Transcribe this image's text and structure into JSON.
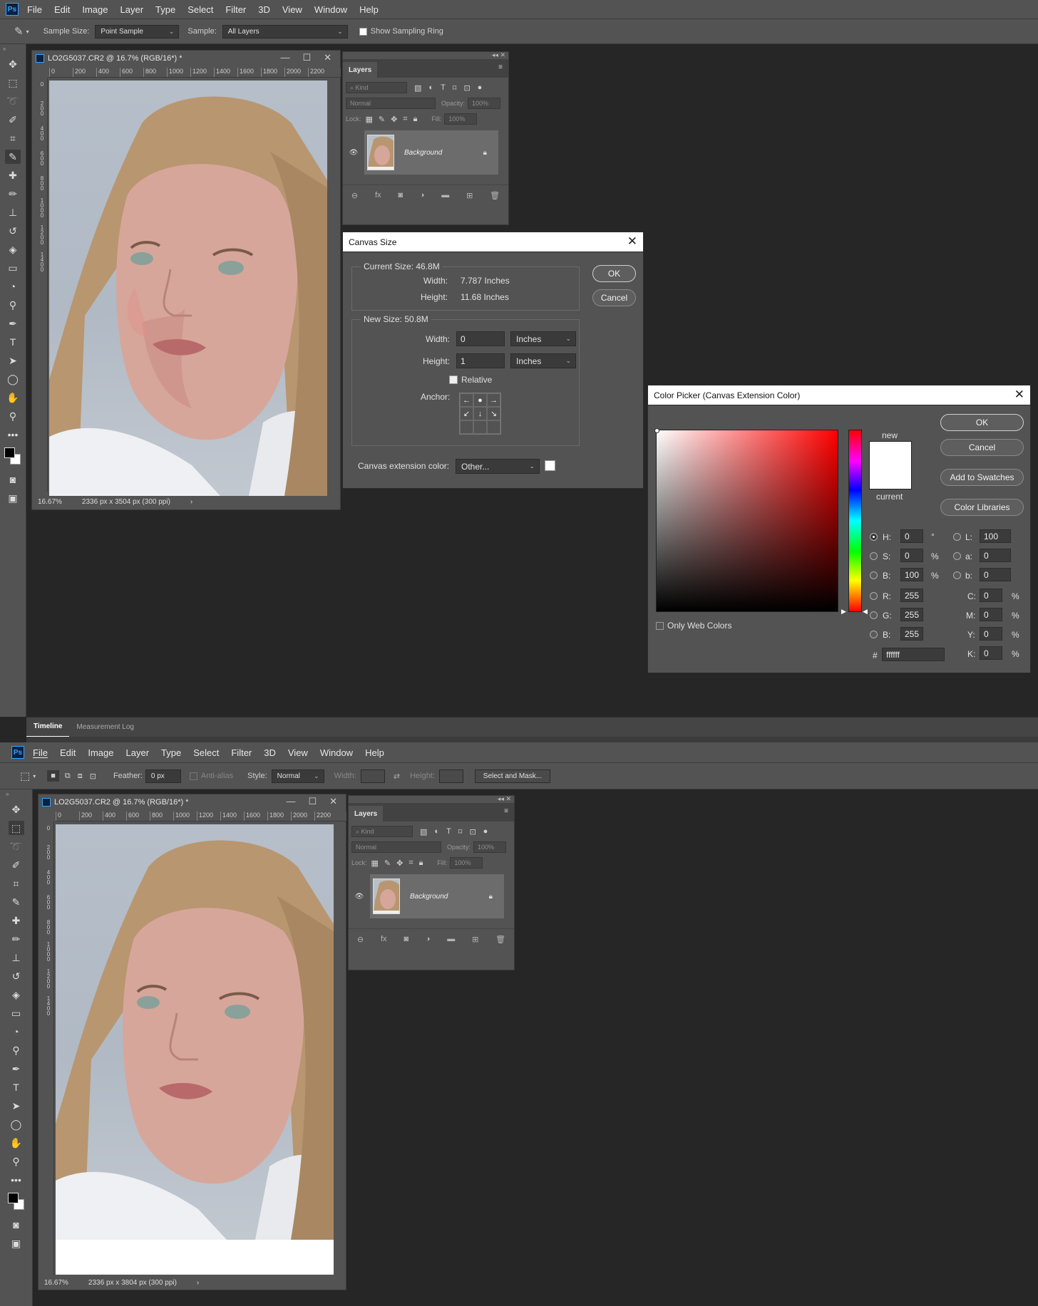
{
  "app": {
    "logo": "Ps"
  },
  "menu": [
    "File",
    "Edit",
    "Image",
    "Layer",
    "Type",
    "Select",
    "Filter",
    "3D",
    "View",
    "Window",
    "Help"
  ],
  "options_top": {
    "sample_size_label": "Sample Size:",
    "sample_size_value": "Point Sample",
    "sample_label": "Sample:",
    "sample_value": "All Layers",
    "sampling_ring_label": "Show Sampling Ring"
  },
  "options_bottom": {
    "feather_label": "Feather:",
    "feather_value": "0 px",
    "antialias_label": "Anti-alias",
    "style_label": "Style:",
    "style_value": "Normal",
    "width_label": "Width:",
    "height_label": "Height:",
    "select_mask_label": "Select and Mask..."
  },
  "document": {
    "title": "LO2G5037.CR2 @ 16.7% (RGB/16*) *",
    "ruler_h": [
      "0",
      "200",
      "400",
      "600",
      "800",
      "1000",
      "1200",
      "1400",
      "1600",
      "1800",
      "2000",
      "2200"
    ],
    "ruler_v": [
      "0",
      "2\n0\n0",
      "4\n0\n0",
      "6\n0\n0",
      "8\n0\n0",
      "1\n0\n0\n0",
      "1\n2\n0\n0",
      "1\n4\n0\n0"
    ],
    "zoom": "16.67%",
    "dims_top": "2336 px x 3504 px (300 ppi)",
    "dims_bottom": "2336 px x 3804 px (300 ppi)"
  },
  "layers": {
    "tab": "Layers",
    "kind": "Kind",
    "blend": "Normal",
    "opacity_label": "Opacity:",
    "opacity_value": "100%",
    "lock_label": "Lock:",
    "fill_label": "Fill:",
    "fill_value": "100%",
    "layer_name": "Background"
  },
  "canvas_size": {
    "title": "Canvas Size",
    "current_size": "Current Size: 46.8M",
    "width_label": "Width:",
    "width_value": "7.787 Inches",
    "height_label": "Height:",
    "height_value": "11.68 Inches",
    "new_size": "New Size: 50.8M",
    "new_width": "0",
    "new_height": "1",
    "unit": "Inches",
    "relative_label": "Relative",
    "anchor_label": "Anchor:",
    "ext_label": "Canvas extension color:",
    "ext_value": "Other...",
    "ok": "OK",
    "cancel": "Cancel"
  },
  "color_picker": {
    "title": "Color Picker (Canvas Extension Color)",
    "ok": "OK",
    "cancel": "Cancel",
    "add_swatches": "Add to Swatches",
    "libraries": "Color Libraries",
    "new_label": "new",
    "current_label": "current",
    "web_colors": "Only Web Colors",
    "h_label": "H:",
    "h": "0",
    "deg": "°",
    "s_label": "S:",
    "s": "0",
    "b_label": "B:",
    "b": "100",
    "pct": "%",
    "r_label": "R:",
    "r": "255",
    "g_label": "G:",
    "g": "255",
    "bb_label": "B:",
    "bb": "255",
    "l_label": "L:",
    "l": "100",
    "a_label": "a:",
    "a": "0",
    "lb_label": "b:",
    "lb": "0",
    "c_label": "C:",
    "c": "0",
    "m_label": "M:",
    "m": "0",
    "y_label": "Y:",
    "y": "0",
    "k_label": "K:",
    "k": "0",
    "hex_label": "#",
    "hex": "ffffff"
  },
  "bottom_panel": {
    "tabs": [
      "Timeline",
      "Measurement Log"
    ]
  },
  "colors": {
    "accent": "#30a6ff",
    "ui_gray": "#535353",
    "workspace": "#262626"
  }
}
